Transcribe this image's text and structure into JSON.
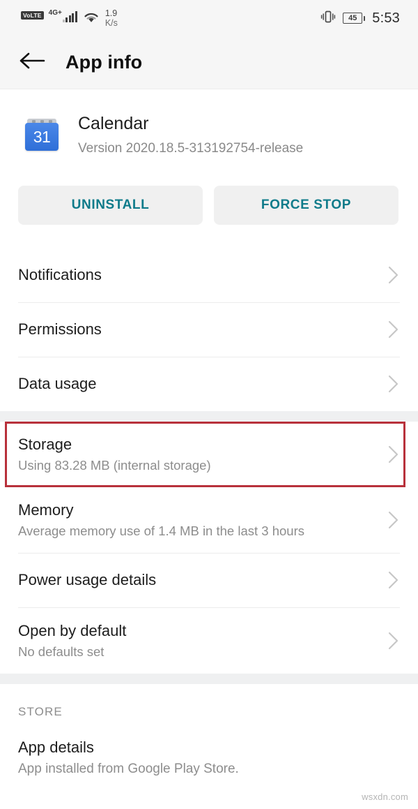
{
  "statusbar": {
    "volte_label": "VoLTE",
    "network_type": "4G+",
    "data_rate_value": "1.9",
    "data_rate_unit": "K/s",
    "battery_level": "45",
    "time": "5:53",
    "icons": {
      "signal": "signal-bars-icon",
      "wifi": "wifi-icon",
      "vibrate": "vibrate-icon",
      "battery": "battery-icon"
    }
  },
  "appbar": {
    "back_icon": "arrow-left-icon",
    "title": "App info"
  },
  "app": {
    "icon_day": "31",
    "name": "Calendar",
    "version": "Version 2020.18.5-313192754-release"
  },
  "actions": {
    "uninstall_label": "UNINSTALL",
    "force_stop_label": "FORCE STOP",
    "accent_color": "#0f7b8a"
  },
  "list": {
    "group1": [
      {
        "title": "Notifications",
        "sub": ""
      },
      {
        "title": "Permissions",
        "sub": ""
      },
      {
        "title": "Data usage",
        "sub": ""
      }
    ],
    "group2": [
      {
        "title": "Storage",
        "sub": "Using 83.28 MB (internal storage)",
        "highlighted": true
      },
      {
        "title": "Memory",
        "sub": "Average memory use of 1.4 MB in the last 3 hours",
        "highlighted": false
      },
      {
        "title": "Power usage details",
        "sub": "",
        "highlighted": false
      },
      {
        "title": "Open by default",
        "sub": "No defaults set",
        "highlighted": false
      }
    ]
  },
  "store": {
    "section_label": "STORE",
    "title": "App details",
    "sub": "App installed from Google Play Store."
  },
  "annotation": {
    "color": "#b8313b",
    "target": "Storage"
  },
  "watermark": "wsxdn.com"
}
